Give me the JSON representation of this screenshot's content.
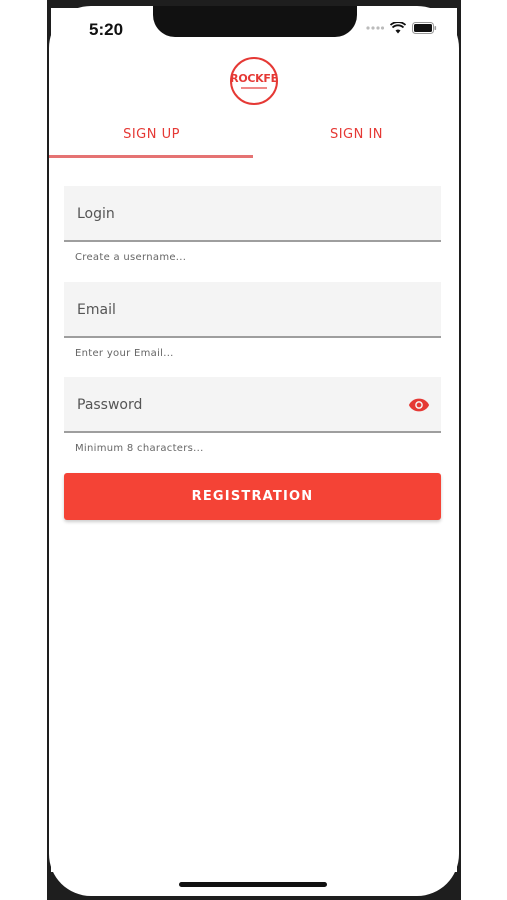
{
  "status_bar": {
    "time": "5:20"
  },
  "logo": {
    "text": "ROCKFE"
  },
  "tabs": [
    {
      "label": "SIGN UP",
      "active": true
    },
    {
      "label": "SIGN IN",
      "active": false
    }
  ],
  "form": {
    "login": {
      "placeholder": "Login",
      "helper": "Create a username..."
    },
    "email": {
      "placeholder": "Email",
      "helper": "Enter your Email..."
    },
    "password": {
      "placeholder": "Password",
      "helper": "Minimum 8 characters..."
    },
    "submit_label": "REGISTRATION"
  },
  "colors": {
    "accent": "#e53935",
    "button": "#f44336"
  },
  "icons": {
    "password_toggle": "eye-icon"
  }
}
